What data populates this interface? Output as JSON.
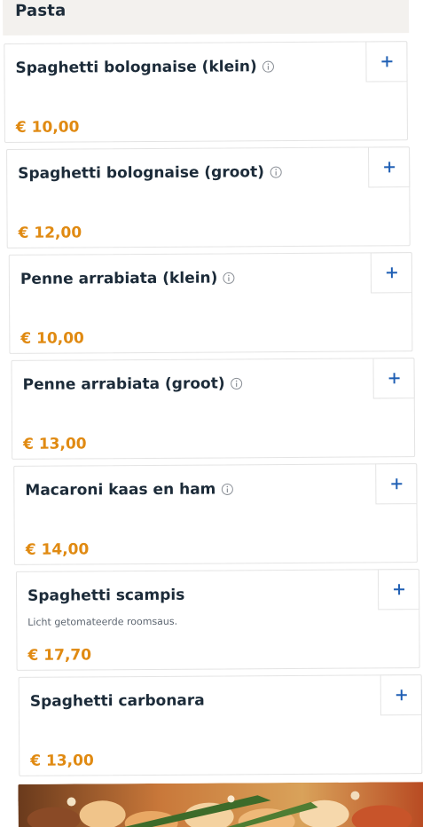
{
  "section": {
    "title": "Pasta"
  },
  "items": [
    {
      "name": "Spaghetti bolognaise (klein)",
      "price": "€ 10,00",
      "description": "",
      "has_info": true
    },
    {
      "name": "Spaghetti bolognaise (groot)",
      "price": "€ 12,00",
      "description": "",
      "has_info": true
    },
    {
      "name": "Penne arrabiata (klein)",
      "price": "€ 10,00",
      "description": "",
      "has_info": true
    },
    {
      "name": "Penne arrabiata (groot)",
      "price": "€ 13,00",
      "description": "",
      "has_info": true
    },
    {
      "name": "Macaroni kaas en ham",
      "price": "€ 14,00",
      "description": "",
      "has_info": true
    },
    {
      "name": "Spaghetti scampis",
      "price": "€ 17,70",
      "description": "Licht getomateerde roomsaus.",
      "has_info": false
    },
    {
      "name": "Spaghetti carbonara",
      "price": "€ 13,00",
      "description": "",
      "has_info": false
    }
  ],
  "icons": {
    "add": "plus-icon",
    "info": "info-icon"
  },
  "colors": {
    "title": "#1c2b39",
    "price": "#e08a12",
    "accent": "#1f5fb4",
    "header_bg": "#f3f1ee",
    "border": "#e4e4e4"
  }
}
